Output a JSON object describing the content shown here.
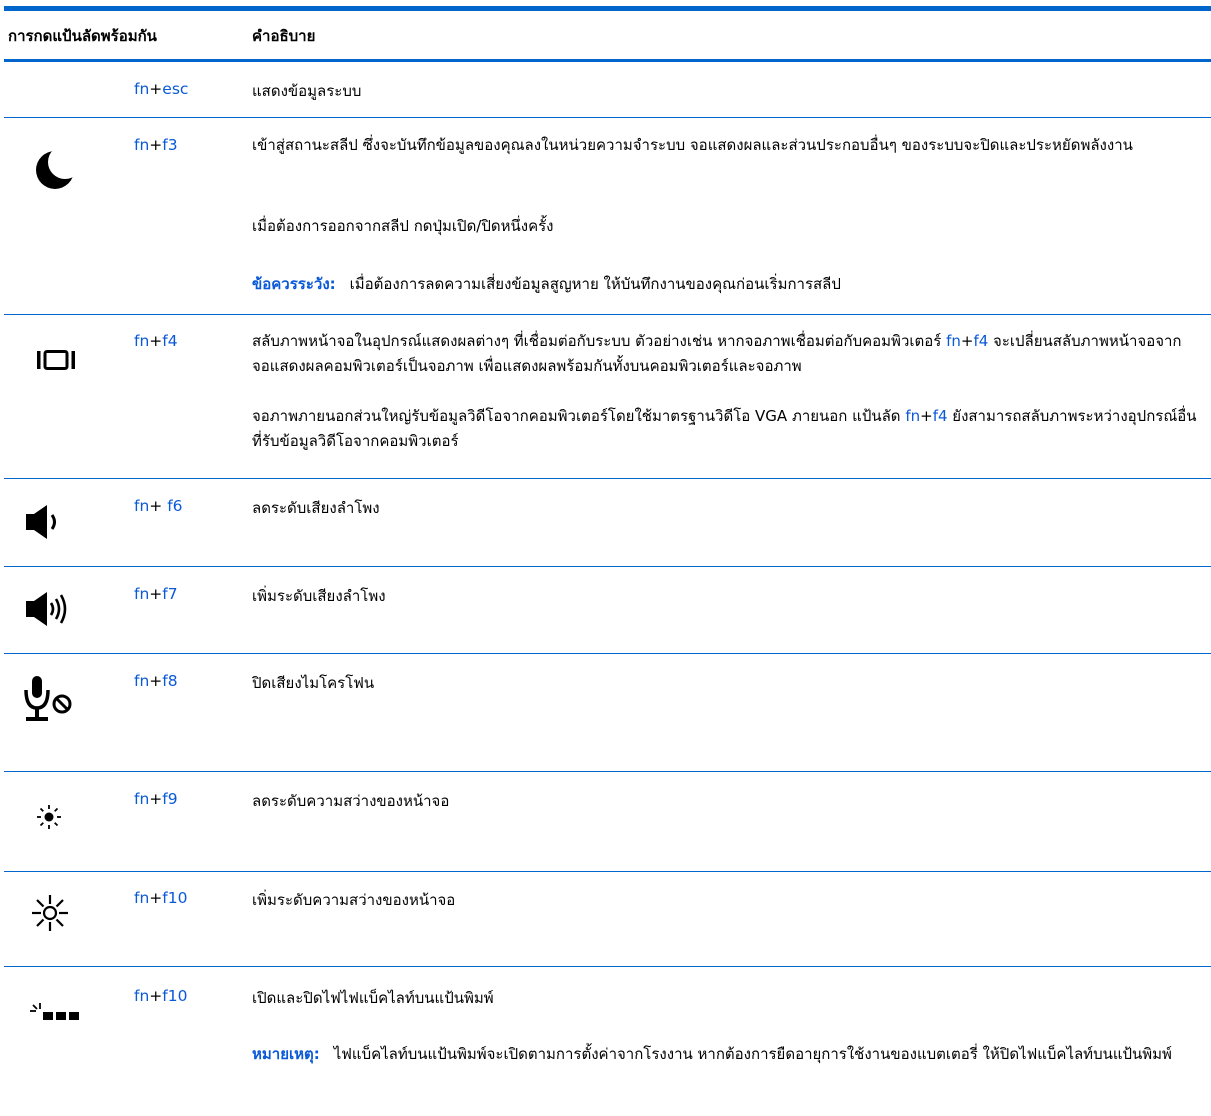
{
  "header": {
    "col1": "การกดแป้นลัดพร้อมกัน",
    "col2": "คำอธิบาย"
  },
  "rows": [
    {
      "icon": "none",
      "key": {
        "fn": "fn",
        "plus": "+",
        "k": "esc"
      },
      "desc": [
        "แสดงข้อมูลระบบ"
      ]
    },
    {
      "icon": "moon-icon",
      "key": {
        "fn": "fn",
        "plus": "+",
        "k": "f3"
      },
      "desc": [
        "เข้าสู่สถานะสลีป ซึ่งจะบันทึกข้อมูลของคุณลงในหน่วยความจำระบบ จอแสดงผลและส่วนประกอบอื่นๆ ของระบบจะปิดและประหยัดพลังงาน",
        "เมื่อต้องการออกจากสลีป กดปุ่มเปิด/ปิดหนึ่งครั้ง"
      ],
      "note_label": "ข้อควรระวัง:",
      "note_text": "เมื่อต้องการลดความเสี่ยงข้อมูลสูญหาย ให้บันทึกงานของคุณก่อนเริ่มการสลีป"
    },
    {
      "icon": "display-switch-icon",
      "key": {
        "fn": "fn",
        "plus": "+",
        "k": "f4"
      },
      "desc1_a": "สลับภาพหน้าจอในอุปกรณ์แสดงผลต่างๆ ที่เชื่อมต่อกับระบบ ตัวอย่างเช่น หากจอภาพเชื่อมต่อกับคอมพิวเตอร์ ",
      "desc1_b": " จะเปลี่ยนสลับภาพหน้าจอจากจอแสดงผลคอมพิวเตอร์เป็นจอภาพ เพื่อแสดงผลพร้อมกันทั้งบนคอมพิวเตอร์และจอภาพ",
      "desc2_a": "จอภาพภายนอกส่วนใหญ่รับข้อมูลวิดีโอจากคอมพิวเตอร์โดยใช้มาตรฐานวิดีโอ VGA ภายนอก แป้นลัด ",
      "desc2_b": " ยังสามารถสลับภาพระหว่างอุปกรณ์อื่นที่รับข้อมูลวิดีโอจากคอมพิวเตอร์"
    },
    {
      "icon": "volume-down-icon",
      "key": {
        "fn": "fn",
        "plus": "+ ",
        "k": "f6"
      },
      "desc": [
        "ลดระดับเสียงลำโพง"
      ]
    },
    {
      "icon": "volume-up-icon",
      "key": {
        "fn": "fn",
        "plus": "+",
        "k": "f7"
      },
      "desc": [
        "เพิ่มระดับเสียงลำโพง"
      ]
    },
    {
      "icon": "microphone-mute-icon",
      "key": {
        "fn": "fn",
        "plus": "+",
        "k": "f8"
      },
      "desc": [
        "ปิดเสียงไมโครโฟน"
      ]
    },
    {
      "icon": "brightness-down-icon",
      "key": {
        "fn": "fn",
        "plus": "+",
        "k": "f9"
      },
      "desc": [
        "ลดระดับความสว่างของหน้าจอ"
      ]
    },
    {
      "icon": "brightness-up-icon",
      "key": {
        "fn": "fn",
        "plus": "+",
        "k": "f10"
      },
      "desc": [
        "เพิ่มระดับความสว่างของหน้าจอ"
      ]
    },
    {
      "icon": "keyboard-backlight-icon",
      "key": {
        "fn": "fn",
        "plus": "+",
        "k": "f10"
      },
      "desc": [
        "เปิดและปิดไฟไฟแบ็คไลท์บนแป้นพิมพ์"
      ],
      "note_label": "หมายเหตุ:",
      "note_text": "ไฟแบ็คไลท์บนแป้นพิมพ์จะเปิดตามการตั้งค่าจากโรงงาน หากต้องการยืดอายุการใช้งานของแบตเตอรี่ ให้ปิดไฟแบ็คไลท์บนแป้นพิมพ์"
    }
  ],
  "colors": {
    "accent": "#0066cc",
    "link": "#0a59d8"
  }
}
